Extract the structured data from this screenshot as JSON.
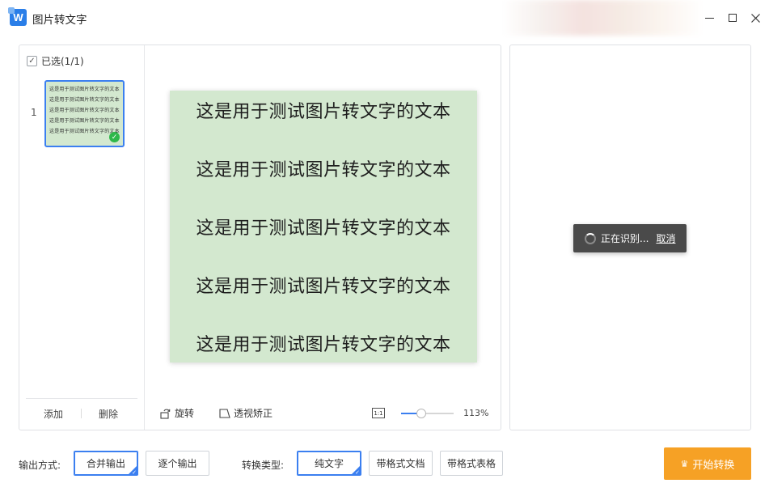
{
  "window": {
    "logo_letter": "W",
    "title": "图片转文字"
  },
  "sidebar": {
    "select_all_label": "已选(1/1)",
    "select_all_checked": true,
    "thumbnails": [
      {
        "index": "1",
        "selected": true,
        "lines": [
          "这是用于测试图片转文字的文本",
          "这是用于测试图片转文字的文本",
          "这是用于测试图片转文字的文本",
          "这是用于测试图片转文字的文本",
          "这是用于测试图片转文字的文本"
        ]
      }
    ],
    "add_label": "添加",
    "delete_label": "删除"
  },
  "preview": {
    "background": "#d3e8cf",
    "lines": [
      "这是用于测试图片转文字的文本",
      "这是用于测试图片转文字的文本",
      "这是用于测试图片转文字的文本",
      "这是用于测试图片转文字的文本",
      "这是用于测试图片转文字的文本"
    ]
  },
  "toolbar": {
    "rotate_label": "旋转",
    "perspective_label": "透视矫正",
    "ratio_icon_text": "1:1",
    "zoom_label": "113%",
    "zoom_fraction": 0.38
  },
  "result_panel": {
    "status_text": "正在识别...",
    "cancel_label": "取消"
  },
  "bottom": {
    "output_label": "输出方式:",
    "output_options": [
      {
        "label": "合并输出",
        "selected": true
      },
      {
        "label": "逐个输出",
        "selected": false
      }
    ],
    "convert_label": "转换类型:",
    "convert_options": [
      {
        "label": "纯文字",
        "selected": true
      },
      {
        "label": "带格式文档",
        "selected": false
      },
      {
        "label": "带格式表格",
        "selected": false
      }
    ],
    "start_label": "开始转换",
    "start_color": "#f6a125",
    "accent_color": "#3b7ff0"
  }
}
